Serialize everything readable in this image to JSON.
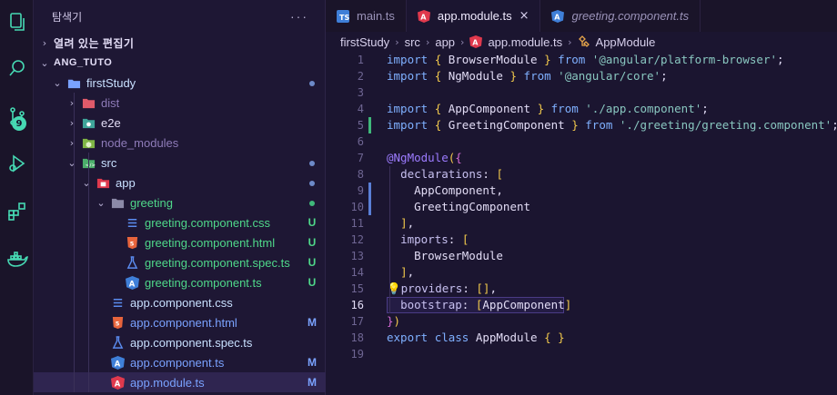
{
  "colors": {
    "accent": "#46d9b3",
    "added": "#3fb87a",
    "modified": "#5a7fd6",
    "untracked_text": "#4fd88a",
    "modified_text": "#7aa2ff",
    "ignored_text": "#8e7bb8"
  },
  "activity_bar": {
    "items": [
      "explorer-icon",
      "search-icon",
      "source-control-icon",
      "run-debug-icon",
      "extensions-icon",
      "docker-icon"
    ],
    "scm_badge": "9"
  },
  "sidebar": {
    "title": "탐색기",
    "more": "···",
    "open_editors": "열려 있는 편집기",
    "workspace": "ANG_TUTO",
    "tree": [
      {
        "label": "firstStudy",
        "icon": "folder-open-icon",
        "decoration": "dot",
        "color": "#c8e0ff"
      },
      {
        "label": "dist",
        "icon": "folder-red-icon",
        "decoration": "",
        "color": "#8e7bb8"
      },
      {
        "label": "e2e",
        "icon": "folder-e2e-icon",
        "decoration": "",
        "color": "#e2dcf5"
      },
      {
        "label": "node_modules",
        "icon": "folder-node-icon",
        "decoration": "",
        "color": "#8e7bb8"
      },
      {
        "label": "src",
        "icon": "folder-src-icon",
        "decoration": "dot",
        "color": "#c8e0ff"
      },
      {
        "label": "app",
        "icon": "folder-app-icon",
        "decoration": "dot",
        "color": "#c8e0ff"
      },
      {
        "label": "greeting",
        "icon": "folder-icon",
        "decoration": "dot-green",
        "color": "#4fd88a"
      },
      {
        "label": "greeting.component.css",
        "icon": "css-file-icon",
        "decoration": "U",
        "color": "#4fd88a"
      },
      {
        "label": "greeting.component.html",
        "icon": "html-file-icon",
        "decoration": "U",
        "color": "#4fd88a"
      },
      {
        "label": "greeting.component.spec.ts",
        "icon": "spec-file-icon",
        "decoration": "U",
        "color": "#4fd88a"
      },
      {
        "label": "greeting.component.ts",
        "icon": "angular-component-icon",
        "decoration": "U",
        "color": "#4fd88a"
      },
      {
        "label": "app.component.css",
        "icon": "css-file-icon",
        "decoration": "",
        "color": "#c8e0ff"
      },
      {
        "label": "app.component.html",
        "icon": "html-file-icon",
        "decoration": "M",
        "color": "#7aa2ff"
      },
      {
        "label": "app.component.spec.ts",
        "icon": "spec-file-icon",
        "decoration": "",
        "color": "#c8e0ff"
      },
      {
        "label": "app.component.ts",
        "icon": "angular-component-icon",
        "decoration": "M",
        "color": "#7aa2ff"
      },
      {
        "label": "app.module.ts",
        "icon": "angular-module-icon",
        "decoration": "M",
        "color": "#7aa2ff"
      }
    ]
  },
  "tabs": [
    {
      "label": "main.ts",
      "icon": "typescript-icon",
      "active": false
    },
    {
      "label": "app.module.ts",
      "icon": "angular-module-icon",
      "active": true,
      "close": "×"
    },
    {
      "label": "greeting.component.ts",
      "icon": "angular-component-icon",
      "active": false
    }
  ],
  "breadcrumb": [
    "firstStudy",
    "src",
    "app",
    "app.module.ts",
    "AppModule"
  ],
  "editor": {
    "line_numbers": [
      "1",
      "2",
      "3",
      "4",
      "5",
      "6",
      "7",
      "8",
      "9",
      "10",
      "11",
      "12",
      "13",
      "14",
      "15",
      "16",
      "17",
      "18",
      "19"
    ],
    "lines": [
      [
        [
          "kw",
          "import "
        ],
        [
          "br1",
          "{ "
        ],
        [
          "id",
          "BrowserModule "
        ],
        [
          "br1",
          "}"
        ],
        [
          "kw",
          " from "
        ],
        [
          "str",
          "'@angular/platform-browser'"
        ],
        [
          "id",
          ";"
        ]
      ],
      [
        [
          "kw",
          "import "
        ],
        [
          "br1",
          "{ "
        ],
        [
          "id",
          "NgModule "
        ],
        [
          "br1",
          "}"
        ],
        [
          "kw",
          " from "
        ],
        [
          "str",
          "'@angular/core'"
        ],
        [
          "id",
          ";"
        ]
      ],
      [],
      [
        [
          "kw",
          "import "
        ],
        [
          "br1",
          "{ "
        ],
        [
          "id",
          "AppComponent "
        ],
        [
          "br1",
          "}"
        ],
        [
          "kw",
          " from "
        ],
        [
          "str",
          "'./app.component'"
        ],
        [
          "id",
          ";"
        ]
      ],
      [
        [
          "kw",
          "import "
        ],
        [
          "br1",
          "{ "
        ],
        [
          "id",
          "GreetingComponent "
        ],
        [
          "br1",
          "}"
        ],
        [
          "kw",
          " from "
        ],
        [
          "str",
          "'./greeting/greeting.component'"
        ],
        [
          "id",
          ";"
        ]
      ],
      [],
      [
        [
          "dec2",
          "@NgModule"
        ],
        [
          "br1",
          "("
        ],
        [
          "br2",
          "{"
        ]
      ],
      [
        [
          "id",
          "  "
        ],
        [
          "prop",
          "declarations"
        ],
        [
          "id",
          ": "
        ],
        [
          "br1",
          "["
        ]
      ],
      [
        [
          "id",
          "    AppComponent,"
        ]
      ],
      [
        [
          "id",
          "    GreetingComponent"
        ]
      ],
      [
        [
          "id",
          "  "
        ],
        [
          "br1",
          "]"
        ],
        [
          "id",
          ","
        ]
      ],
      [
        [
          "id",
          "  "
        ],
        [
          "prop",
          "imports"
        ],
        [
          "id",
          ": "
        ],
        [
          "br1",
          "["
        ]
      ],
      [
        [
          "id",
          "    BrowserModule"
        ]
      ],
      [
        [
          "id",
          "  "
        ],
        [
          "br1",
          "]"
        ],
        [
          "id",
          ","
        ]
      ],
      [
        [
          "id",
          "💡"
        ],
        [
          "prop",
          "providers"
        ],
        [
          "id",
          ": "
        ],
        [
          "br1",
          "[]"
        ],
        [
          "id",
          ","
        ]
      ],
      [
        [
          "id",
          "  "
        ],
        [
          "prop",
          "bootstrap"
        ],
        [
          "id",
          ": "
        ],
        [
          "br1",
          "["
        ],
        [
          "id",
          "AppComponent"
        ],
        [
          "br1",
          "]"
        ]
      ],
      [
        [
          "br2",
          "}"
        ],
        [
          "br1",
          ")"
        ]
      ],
      [
        [
          "kw",
          "export "
        ],
        [
          "kw",
          "class "
        ],
        [
          "id",
          "AppModule "
        ],
        [
          "br1",
          "{ }"
        ]
      ],
      []
    ]
  }
}
